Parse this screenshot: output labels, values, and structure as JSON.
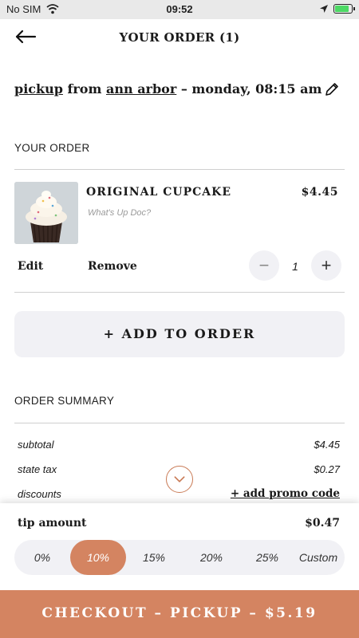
{
  "status_bar": {
    "carrier": "No SIM",
    "time": "09:52"
  },
  "header": {
    "title": "YOUR ORDER (1)"
  },
  "pickup": {
    "mode": "pickup",
    "from_text": " from ",
    "location": "ann arbor",
    "datetime": " – monday, 08:15 am"
  },
  "order_section": {
    "label": "YOUR ORDER"
  },
  "item": {
    "name": "ORIGINAL CUPCAKE",
    "subtitle": "What's Up Doc?",
    "price": "$4.45",
    "edit_label": "Edit",
    "remove_label": "Remove",
    "quantity": "1",
    "minus_symbol": "−",
    "plus_symbol": "+"
  },
  "add_to_order": {
    "label": "+ ADD TO ORDER"
  },
  "summary": {
    "label": "ORDER SUMMARY",
    "subtotal_label": "subtotal",
    "subtotal_value": "$4.45",
    "tax_label": "state tax",
    "tax_value": "$0.27",
    "discounts_label": "discounts",
    "promo_label": "+ add promo code"
  },
  "tip": {
    "label": "tip amount",
    "value": "$0.47",
    "options": [
      "0%",
      "10%",
      "15%",
      "20%",
      "25%",
      "Custom"
    ],
    "selected": "10%"
  },
  "checkout": {
    "label": "CHECKOUT – PICKUP – $5.19"
  },
  "colors": {
    "accent": "#d48461",
    "light_bg": "#f1f1f5",
    "divider": "#cfcfcf"
  },
  "icons": {
    "back": "back-arrow-icon",
    "edit": "pencil-icon",
    "scroll": "chevron-down-icon",
    "wifi": "wifi-icon",
    "location": "location-arrow-icon",
    "battery": "battery-icon"
  }
}
